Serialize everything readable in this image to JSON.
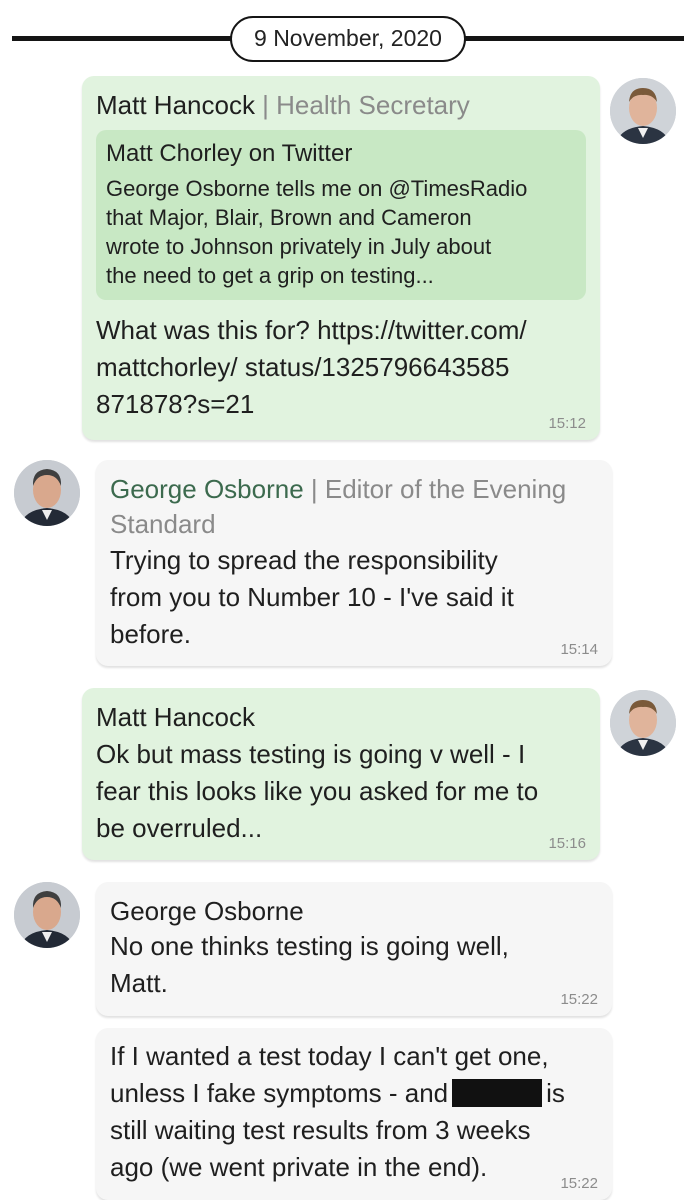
{
  "date_divider": "9 November, 2020",
  "messages": [
    {
      "sender_name": "Matt Hancock",
      "separator": " | ",
      "sender_role": "Health Secretary",
      "quote": {
        "title": "Matt Chorley on Twitter",
        "body_lines": [
          "George Osborne tells me on @TimesRadio",
          "that Major, Blair, Brown and Cameron",
          "wrote to Johnson privately in July about",
          "the need to get a grip on testing..."
        ]
      },
      "lines": [
        "What was this for? https://twitter.com/",
        "mattchorley/ status/1325796643585",
        "871878?s=21"
      ],
      "time": "15:12"
    },
    {
      "sender_name": "George Osborne",
      "separator": " | ",
      "sender_role_line1": "Editor of the Evening",
      "sender_role_line2": "Standard",
      "lines": [
        "Trying to spread the responsibility",
        "from you to Number 10 - I've said it",
        "before."
      ],
      "time": "15:14"
    },
    {
      "sender_name": "Matt Hancock",
      "lines": [
        "Ok but mass testing is going v well - I",
        "fear this looks like you asked for me to",
        "be overruled..."
      ],
      "time": "15:16"
    },
    {
      "sender_name": "George Osborne",
      "lines": [
        "No one thinks testing is going well,",
        "Matt."
      ],
      "time": "15:22"
    },
    {
      "line1": "If I wanted a test today I can't get one,",
      "line2_before": "unless I fake symptoms - and",
      "line2_after": "is",
      "line3": "still waiting test results from 3 weeks",
      "line4": "ago (we went private in the end).",
      "time": "15:22"
    }
  ],
  "colors": {
    "hancock_bubble": "#e1f3df",
    "osborne_bubble": "#f6f6f6",
    "quote_background": "#c8e8c4",
    "osborne_name": "#3c6a4e",
    "role_text": "#8a8a8a"
  }
}
